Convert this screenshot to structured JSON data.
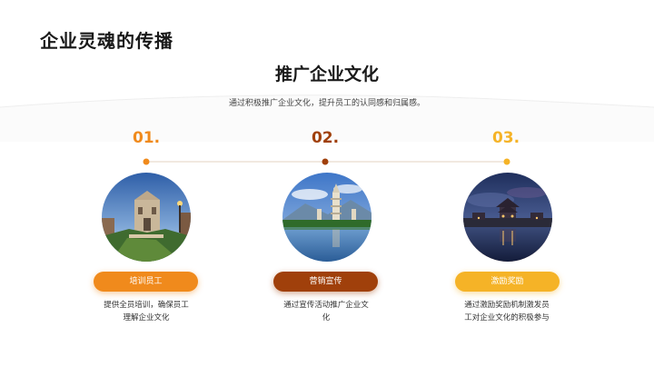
{
  "page_title": "企业灵魂的传播",
  "main_heading": "推广企业文化",
  "subheading": "通过积极推广企业文化，提升员工的认同感和归属感。",
  "colors": {
    "orange": "#f08a1c",
    "brown": "#a0400b",
    "gold": "#f5b327",
    "line": "#e3d3c0"
  },
  "steps": [
    {
      "number": "01.",
      "label": "培训员工",
      "desc_line1": "提供全员培训，确保员工",
      "desc_line2": "理解企业文化",
      "image_icon": "ruins-facade-photo"
    },
    {
      "number": "02.",
      "label": "营销宣传",
      "desc_line1": "通过宣传活动推广企业文",
      "desc_line2": "化",
      "image_icon": "pagoda-lake-photo"
    },
    {
      "number": "03.",
      "label": "激励奖励",
      "desc_line1": "通过激励奖励机制激发员",
      "desc_line2": "工对企业文化的积极参与",
      "image_icon": "temple-dusk-photo"
    }
  ]
}
